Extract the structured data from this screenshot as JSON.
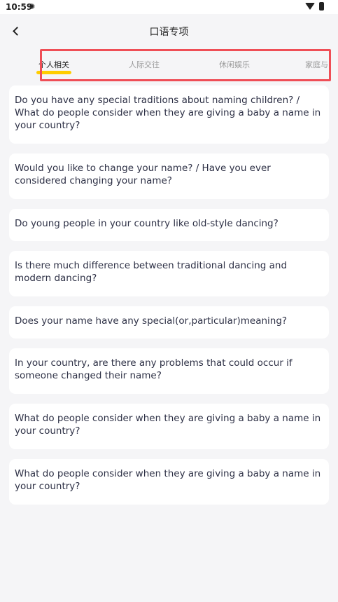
{
  "status_bar": {
    "time": "10:59",
    "notification_icon": "snowflake-icon",
    "wifi_icon": "wifi-icon",
    "battery_icon": "battery-icon"
  },
  "header": {
    "back_icon": "chevron-left-icon",
    "title": "口语专项"
  },
  "tabs": [
    {
      "label": "个人相关",
      "active": true
    },
    {
      "label": "人际交往",
      "active": false
    },
    {
      "label": "休闲娱乐",
      "active": false
    },
    {
      "label": "家庭与",
      "active": false
    }
  ],
  "colors": {
    "accent_underline": "#ffcd00",
    "highlight_border": "#ef4e56",
    "background": "#f5f5f7",
    "card": "#ffffff"
  },
  "questions": [
    "Do you have any special traditions about naming children? / What do people consider when they are giving a baby a name in your country?",
    "Would you like to change your name? / Have you ever considered changing your name?",
    "Do young people in your country like old-style dancing?",
    "Is there much difference between traditional dancing and modern dancing?",
    "Does your name have any special(or,particular)meaning?",
    "In your country, are there any problems that could occur if someone changed their name?",
    "What do people consider when they are giving a baby a name in your country?",
    "What do people consider when they are giving a baby a name in your country?"
  ]
}
